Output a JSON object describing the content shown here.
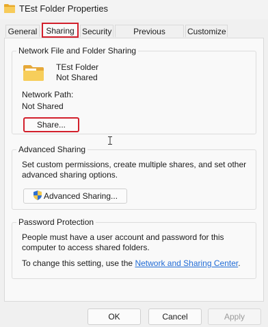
{
  "window": {
    "title": "TEst Folder Properties",
    "icon": "folder-icon"
  },
  "tabs": [
    {
      "label": "General"
    },
    {
      "label": "Sharing",
      "active": true
    },
    {
      "label": "Security"
    },
    {
      "label": "Previous Versions"
    },
    {
      "label": "Customize"
    }
  ],
  "network_sharing": {
    "title": "Network File and Folder Sharing",
    "folder_name": "TEst Folder",
    "folder_status": "Not Shared",
    "network_path_label": "Network Path:",
    "network_path_value": "Not Shared",
    "share_button": "Share..."
  },
  "advanced_sharing": {
    "title": "Advanced Sharing",
    "description": "Set custom permissions, create multiple shares, and set other advanced sharing options.",
    "button": "Advanced Sharing..."
  },
  "password_protection": {
    "title": "Password Protection",
    "description": "People must have a user account and password for this computer to access shared folders.",
    "change_prefix": "To change this setting, use the ",
    "link": "Network and Sharing Center",
    "change_suffix": "."
  },
  "footer": {
    "ok": "OK",
    "cancel": "Cancel",
    "apply": "Apply"
  },
  "colors": {
    "highlight": "#d21f2b",
    "link": "#1f6bd6",
    "folder": "#f2c14e"
  }
}
